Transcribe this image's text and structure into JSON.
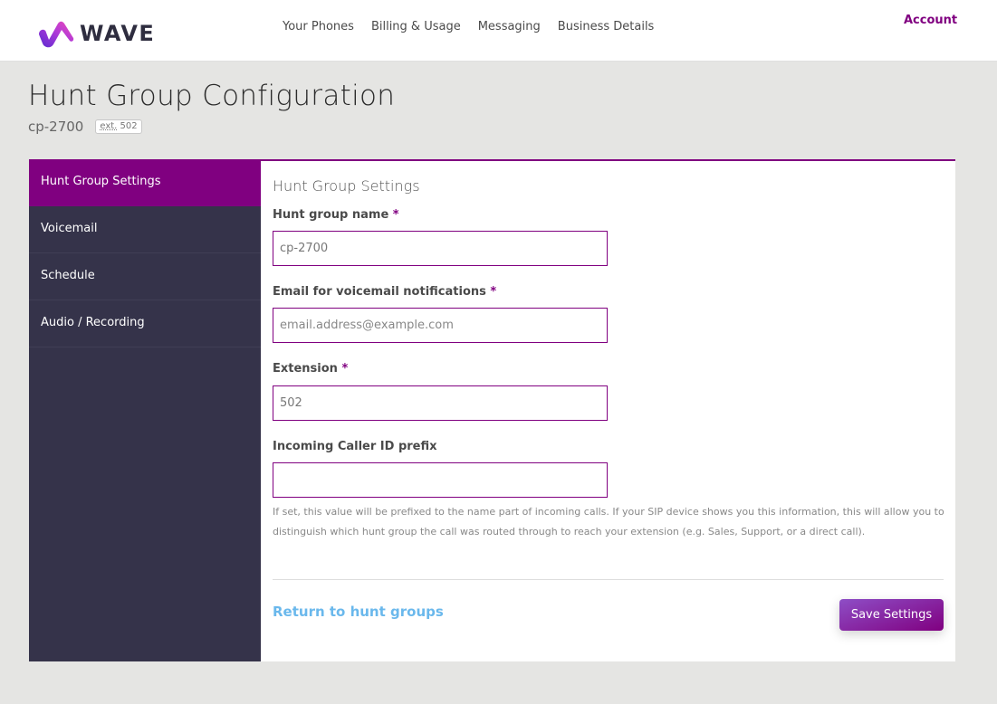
{
  "header": {
    "logo_text": "WAVE",
    "nav": [
      {
        "label": "Your Phones"
      },
      {
        "label": "Billing & Usage"
      },
      {
        "label": "Messaging"
      },
      {
        "label": "Business Details"
      }
    ],
    "account_label": "Account"
  },
  "page": {
    "title": "Hunt Group Configuration",
    "group_name": "cp-2700",
    "ext_abbr": "ext.",
    "ext_number": "502"
  },
  "sidebar": {
    "items": [
      {
        "label": "Hunt Group Settings",
        "active": true
      },
      {
        "label": "Voicemail",
        "active": false
      },
      {
        "label": "Schedule",
        "active": false
      },
      {
        "label": "Audio / Recording",
        "active": false
      }
    ]
  },
  "form": {
    "section_title": "Hunt Group Settings",
    "required_marker": "*",
    "fields": [
      {
        "label": "Hunt group name",
        "required": true,
        "value": "cp-2700",
        "placeholder": ""
      },
      {
        "label": "Email for voicemail notifications",
        "required": true,
        "value": "",
        "placeholder": "email.address@example.com"
      },
      {
        "label": "Extension",
        "required": true,
        "value": "502",
        "placeholder": ""
      },
      {
        "label": "Incoming Caller ID prefix",
        "required": false,
        "value": "",
        "placeholder": ""
      }
    ],
    "help_text": "If set, this value will be prefixed to the name part of incoming calls. If your SIP device shows you this information, this will allow you to distinguish which hunt group the call was routed through to reach your extension (e.g. Sales, Support, or a direct call).",
    "return_link": "Return to hunt groups",
    "save_label": "Save Settings"
  },
  "colors": {
    "brand_purple": "#800080",
    "sidebar_bg": "#35334a",
    "link_blue": "#6ab8ec",
    "page_bg": "#e5e5e3"
  }
}
